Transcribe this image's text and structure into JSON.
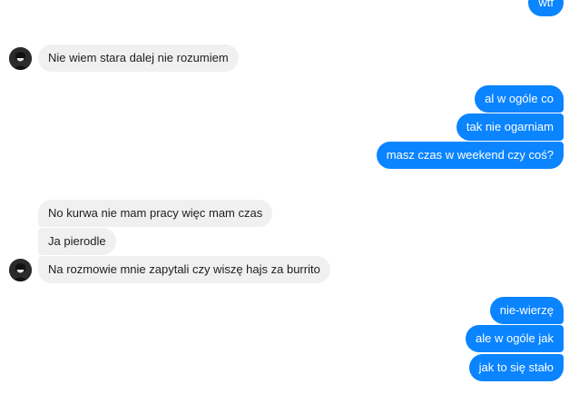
{
  "conversation": {
    "messages": [
      {
        "direction": "outgoing",
        "text": "wtf"
      },
      {
        "direction": "incoming",
        "text": "Nie wiem stara dalej nie rozumiem"
      },
      {
        "direction": "outgoing",
        "text": "al w ogóle co"
      },
      {
        "direction": "outgoing",
        "text": "tak nie ogarniam"
      },
      {
        "direction": "outgoing",
        "text": "masz czas w weekend czy coś?"
      },
      {
        "direction": "incoming",
        "text": "No kurwa nie mam pracy więc mam czas"
      },
      {
        "direction": "incoming",
        "text": "Ja pierodle"
      },
      {
        "direction": "incoming",
        "text": "Na rozmowie mnie zapytali czy wiszę hajs za burrito"
      },
      {
        "direction": "outgoing",
        "text": "nie-wierzę"
      },
      {
        "direction": "outgoing",
        "text": "ale w ogóle jak"
      },
      {
        "direction": "outgoing",
        "text": "jak to się stało"
      }
    ]
  },
  "colors": {
    "outgoing_bubble": "#0a84ff",
    "incoming_bubble": "#f1f0f0"
  },
  "icons": {
    "contact_avatar": "avatar"
  }
}
